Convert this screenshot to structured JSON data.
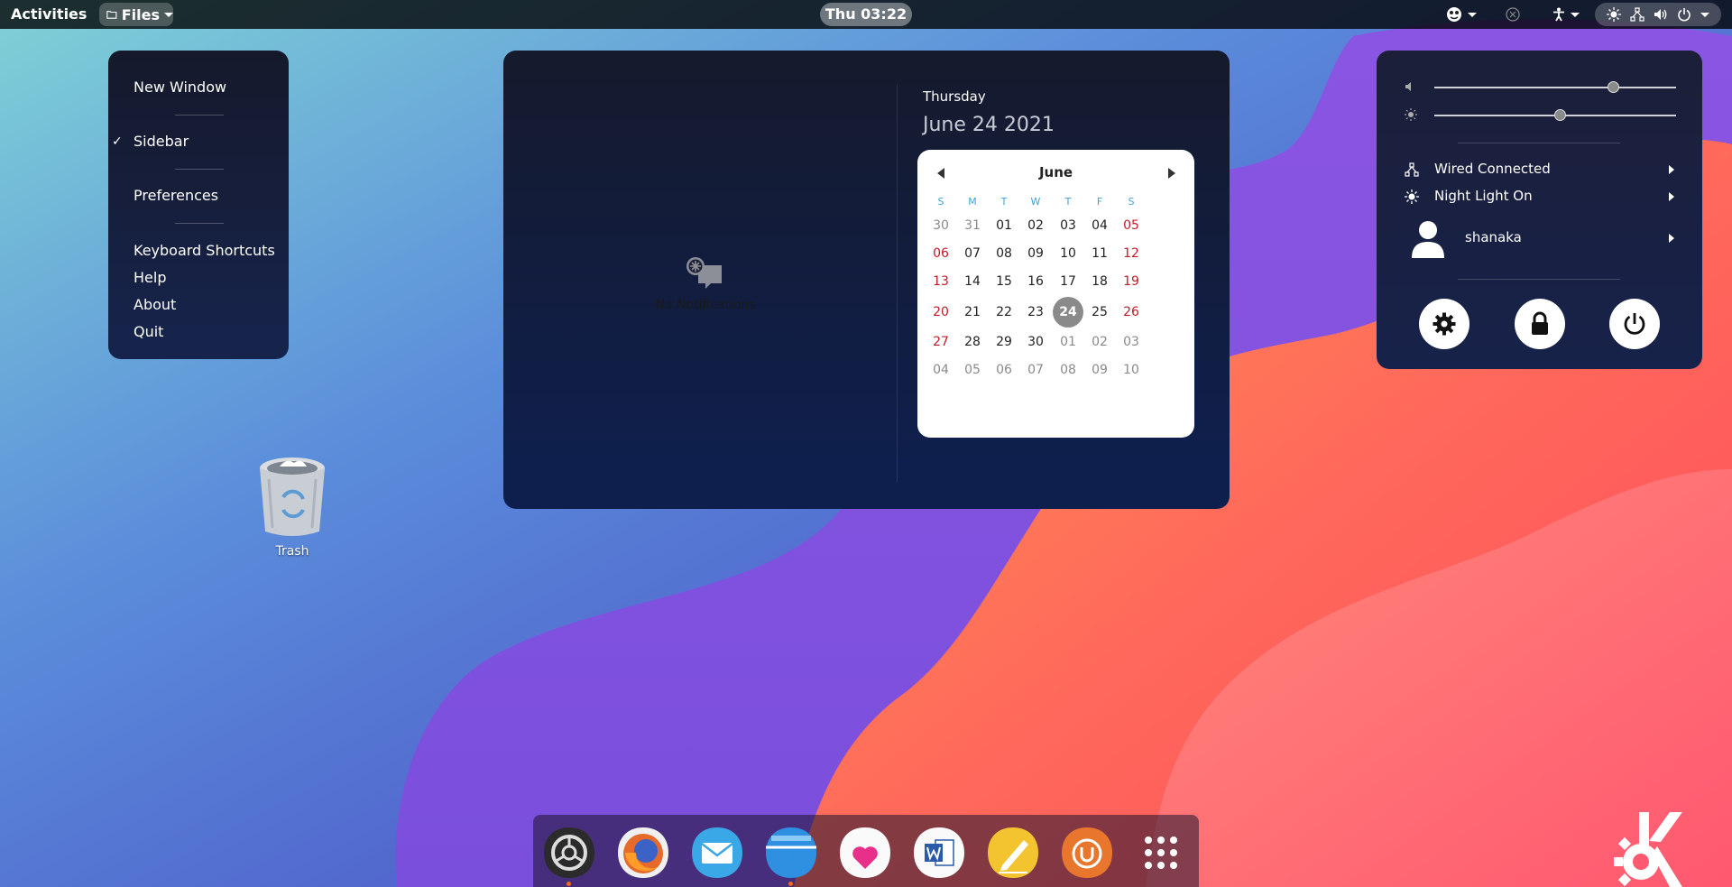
{
  "topbar": {
    "activities": "Activities",
    "app_name": "Files",
    "clock": "Thu 03:22"
  },
  "app_menu": {
    "items": [
      "New Window",
      "Sidebar",
      "Preferences",
      "Keyboard Shortcuts",
      "Help",
      "About",
      "Quit"
    ],
    "checked_item": "Sidebar",
    "check_mark": "✓"
  },
  "notifications": {
    "empty_text": "No Notifications"
  },
  "calendar": {
    "weekday": "Thursday",
    "date": "June 24 2021",
    "month": "June",
    "days_of_week": [
      "S",
      "M",
      "T",
      "W",
      "T",
      "F",
      "S"
    ],
    "weeks": [
      [
        "30",
        "31",
        "01",
        "02",
        "03",
        "04",
        "05"
      ],
      [
        "06",
        "07",
        "08",
        "09",
        "10",
        "11",
        "12"
      ],
      [
        "13",
        "14",
        "15",
        "16",
        "17",
        "18",
        "19"
      ],
      [
        "20",
        "21",
        "22",
        "23",
        "24",
        "25",
        "26"
      ],
      [
        "27",
        "28",
        "29",
        "30",
        "01",
        "02",
        "03"
      ],
      [
        "04",
        "05",
        "06",
        "07",
        "08",
        "09",
        "10"
      ]
    ],
    "today": "24",
    "colors": {
      "weekend": "#c01c28",
      "other_month": "#8a8a8a",
      "current": "#222222",
      "dow": "#3fa2d9"
    }
  },
  "quick_settings": {
    "volume_level": 0.74,
    "brightness_level": 0.52,
    "network": "Wired Connected",
    "night_light": "Night Light On",
    "user": "shanaka",
    "buttons": [
      "gear-icon",
      "lock-icon",
      "power-icon"
    ]
  },
  "desktop": {
    "trash_label": "Trash"
  },
  "dock": {
    "apps": [
      "settings",
      "firefox",
      "mail",
      "files",
      "health",
      "word",
      "notes",
      "update",
      "app-grid"
    ],
    "running": [
      "settings",
      "files"
    ]
  }
}
